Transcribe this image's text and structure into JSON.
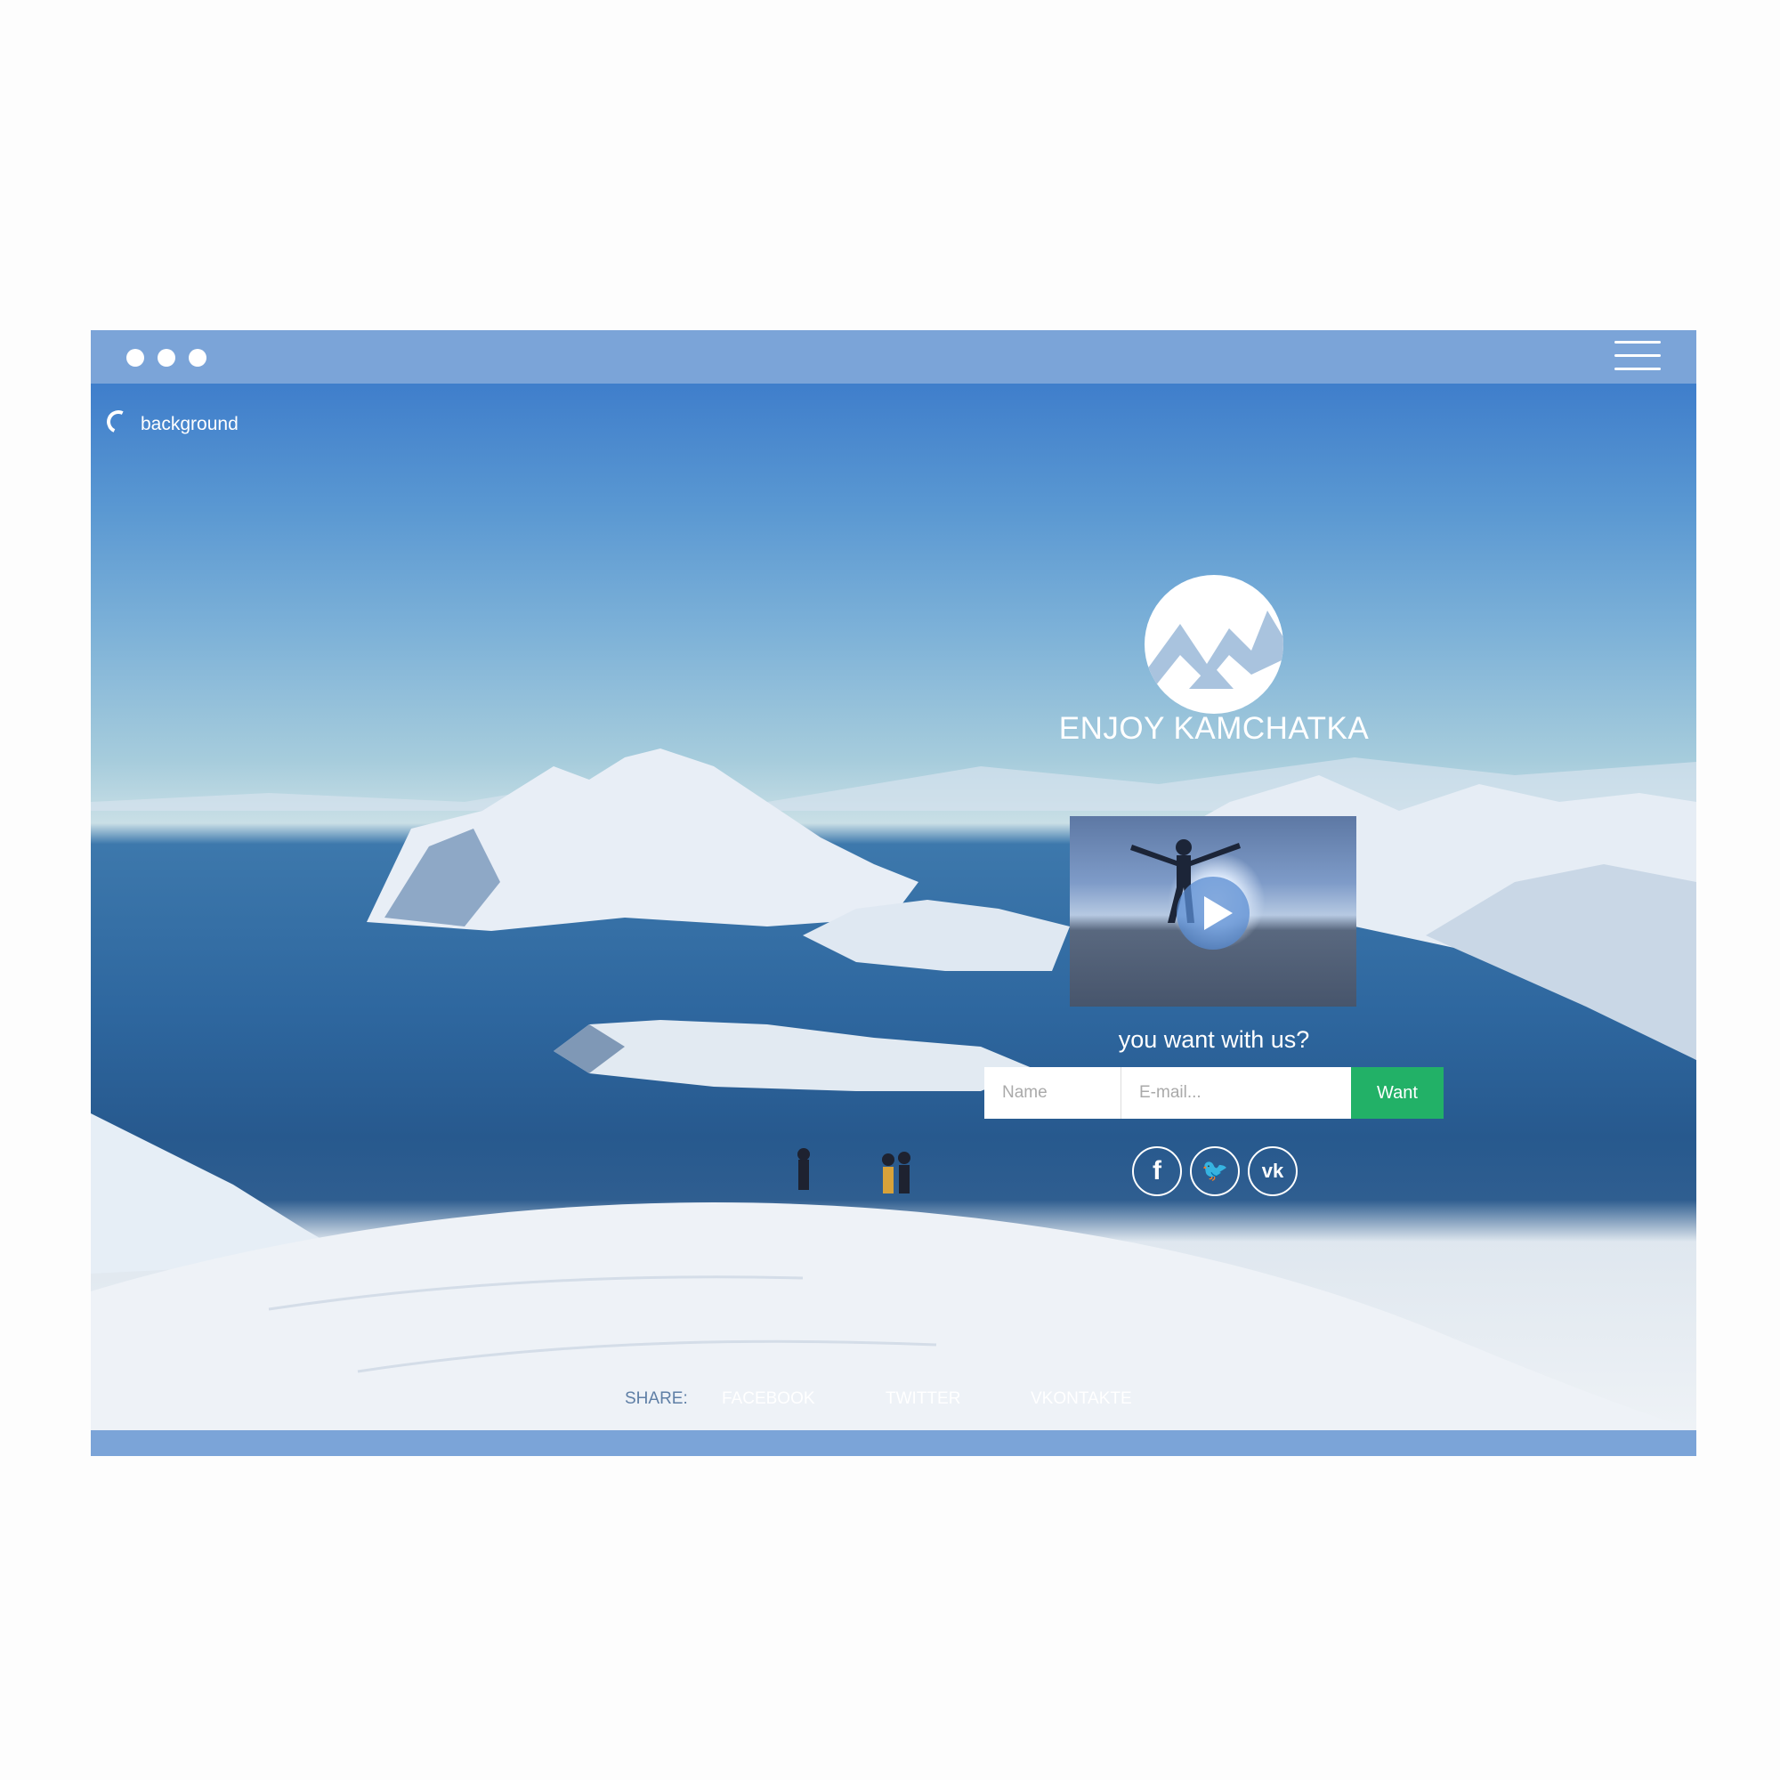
{
  "window": {
    "background_label": "background",
    "accent_color": "#7ba4d8"
  },
  "hero": {
    "headline": "ENJOY KAMCHATKA",
    "question": "you want with us?"
  },
  "form": {
    "name_placeholder": "Name",
    "email_placeholder": "E-mail...",
    "submit_label": "Want",
    "submit_color": "#22b167"
  },
  "social_icons": [
    {
      "name": "facebook-icon",
      "glyph": "f"
    },
    {
      "name": "twitter-icon",
      "glyph": "🐦"
    },
    {
      "name": "vk-icon",
      "glyph": "vk"
    }
  ],
  "share": {
    "label": "SHARE:",
    "links": [
      "FACEBOOK",
      "TWITTER",
      "VKONTAKTE"
    ]
  }
}
